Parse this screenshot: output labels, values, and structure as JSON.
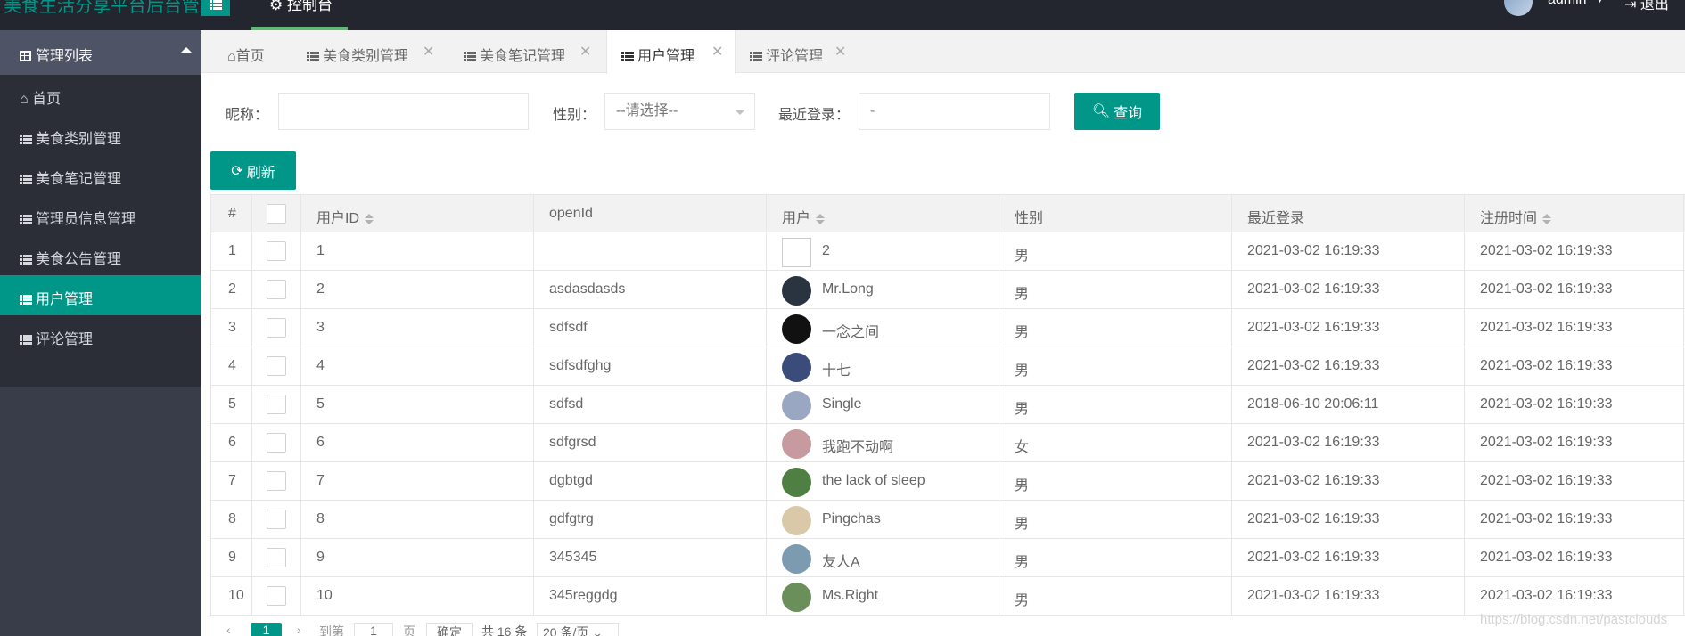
{
  "app": {
    "title": "美食生活分享平台后台管理",
    "top_tab": "控制台",
    "user": "admin",
    "logout": "退出"
  },
  "sidebar": {
    "header": "管理列表",
    "items": [
      {
        "label": "首页",
        "icon": "home-icon"
      },
      {
        "label": "美食类别管理",
        "icon": "list-icon"
      },
      {
        "label": "美食笔记管理",
        "icon": "list-icon"
      },
      {
        "label": "管理员信息管理",
        "icon": "list-icon"
      },
      {
        "label": "美食公告管理",
        "icon": "list-icon"
      },
      {
        "label": "用户管理",
        "icon": "list-icon",
        "active": true
      },
      {
        "label": "评论管理",
        "icon": "list-icon"
      }
    ]
  },
  "tabs": [
    {
      "label": "首页",
      "icon": "home-icon"
    },
    {
      "label": "美食类别管理",
      "icon": "list-icon",
      "close": "✕"
    },
    {
      "label": "美食笔记管理",
      "icon": "list-icon",
      "close": "✕"
    },
    {
      "label": "用户管理",
      "icon": "list-icon",
      "close": "✕",
      "active": true
    },
    {
      "label": "评论管理",
      "icon": "list-icon",
      "close": "✕"
    }
  ],
  "filters": {
    "nickname_label": "昵称：",
    "nickname_value": "",
    "gender_label": "性别：",
    "gender_value": "--请选择--",
    "last_login_label": "最近登录：",
    "last_login_value": "-",
    "search_button": "查询",
    "refresh_button": "刷新"
  },
  "table": {
    "headers": [
      "#",
      "",
      "用户ID",
      "openId",
      "用户",
      "性别",
      "最近登录",
      "注册时间"
    ],
    "rows": [
      {
        "n": "1",
        "uid": "1",
        "openid": "",
        "name": "2",
        "gender": "男",
        "last": "2021-03-02 16:19:33",
        "reg": "2021-03-02 16:19:33",
        "avatar": "broken"
      },
      {
        "n": "2",
        "uid": "2",
        "openid": "asdasdasds",
        "name": "Mr.Long",
        "gender": "男",
        "last": "2021-03-02 16:19:33",
        "reg": "2021-03-02 16:19:33",
        "avatar": "#2a3440"
      },
      {
        "n": "3",
        "uid": "3",
        "openid": "sdfsdf",
        "name": "一念之间",
        "gender": "男",
        "last": "2021-03-02 16:19:33",
        "reg": "2021-03-02 16:19:33",
        "avatar": "#111111"
      },
      {
        "n": "4",
        "uid": "4",
        "openid": "sdfsdfghg",
        "name": "十七",
        "gender": "男",
        "last": "2021-03-02 16:19:33",
        "reg": "2021-03-02 16:19:33",
        "avatar": "#3b4c7a"
      },
      {
        "n": "5",
        "uid": "5",
        "openid": "sdfsd",
        "name": "Single",
        "gender": "男",
        "last": "2018-06-10 20:06:11",
        "reg": "2021-03-02 16:19:33",
        "avatar": "#9aa7c2"
      },
      {
        "n": "6",
        "uid": "6",
        "openid": "sdfgrsd",
        "name": "我跑不动啊",
        "gender": "女",
        "last": "2021-03-02 16:19:33",
        "reg": "2021-03-02 16:19:33",
        "avatar": "#c79aa0"
      },
      {
        "n": "7",
        "uid": "7",
        "openid": "dgbtgd",
        "name": "the lack of sleep",
        "gender": "男",
        "last": "2021-03-02 16:19:33",
        "reg": "2021-03-02 16:19:33",
        "avatar": "#4f7f43"
      },
      {
        "n": "8",
        "uid": "8",
        "openid": "gdfgtrg",
        "name": "Pingchas",
        "gender": "男",
        "last": "2021-03-02 16:19:33",
        "reg": "2021-03-02 16:19:33",
        "avatar": "#d9c9a8"
      },
      {
        "n": "9",
        "uid": "9",
        "openid": "345345",
        "name": "友人A",
        "gender": "男",
        "last": "2021-03-02 16:19:33",
        "reg": "2021-03-02 16:19:33",
        "avatar": "#7d9bb0"
      },
      {
        "n": "10",
        "uid": "10",
        "openid": "345reggdg",
        "name": "Ms.Right",
        "gender": "男",
        "last": "2021-03-02 16:19:33",
        "reg": "2021-03-02 16:19:33",
        "avatar": "#6b8f5a"
      }
    ]
  },
  "pagination": {
    "prev": "‹",
    "page": "1",
    "next": "›",
    "goto_label": "到第",
    "goto_value": "1",
    "page_unit": "页",
    "confirm": "确定",
    "total": "共 16 条",
    "per_page": "20 条/页"
  },
  "watermark": "https://blog.csdn.net/pastclouds",
  "colors": {
    "accent": "#009688",
    "header_bg": "#23262e",
    "sidebar_bg": "#2b2e37"
  }
}
